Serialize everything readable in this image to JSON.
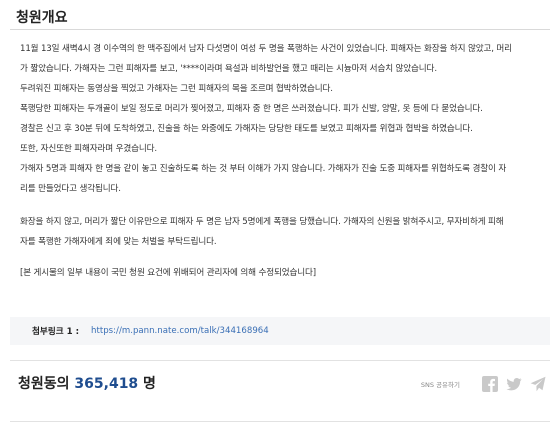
{
  "petition": {
    "section_title": "청원개요",
    "paragraphs": [
      "11월 13일 새벽4시 경 이수역의 한 맥주집에서 남자 다섯명이 여성 두 명을 폭행하는 사건이 있었습니다. 피해자는 화장을 하지 않았고, 머리",
      "가 짧았습니다. 가해자는 그런 피해자를 보고, '****이라며 욕설과 비하발언을 했고 때리는 시늉마저 서슴치 않았습니다.",
      "두려워진 피해자는 동영상을 찍었고 가해자는 그런 피해자의 목을 조르며 협박하였습니다.",
      "폭행당한 피해자는 두개골이 보일 정도로 머리가 찢어졌고, 피해자 중 한 명은 쓰러졌습니다. 피가 신발, 양말, 옷 등에 다 묻었습니다.",
      "경찰은 신고 후 30분 뒤에 도착하였고, 진술을 하는 와중에도 가해자는 당당한 태도를 보였고 피해자를 위협과 협박을 하였습니다.",
      "또한, 자신또한 피해자라며 우겼습니다.",
      "가해자 5명과 피해자 한 명을 같이 놓고 진술하도록 하는 것 부터 이해가 가지 않습니다. 가해자가 진술 도중 피해자를 위협하도록 경찰이 자",
      "리를 만들었다고 생각됩니다.",
      "화장을 하지 않고, 머리가 짧단 이유만으로 피해자 두 명은 남자 5명에게 폭행을 당했습니다. 가해자의 신원을 밝혀주시고, 무자비하게 피해",
      "자를 폭행한 가해자에게 죄에 맞는 처벌을 부탁드립니다.",
      "[본 게시물의 일부 내용이 국민 청원 요건에 위배되어 관리자에 의해 수정되었습니다]"
    ]
  },
  "attachment": {
    "label": "첨부링크 1 :",
    "url": "https://m.pann.nate.com/talk/344168964"
  },
  "signatures": {
    "prefix": "청원동의",
    "count": "365,418",
    "unit": "명"
  },
  "share": {
    "label": "SNS 공유하기",
    "icons": [
      "facebook-icon",
      "twitter-icon",
      "send-icon"
    ]
  }
}
